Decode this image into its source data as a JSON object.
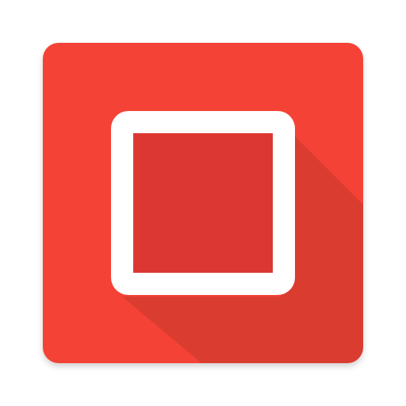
{
  "app_icon": {
    "icon_name": "stop-square-icon",
    "colors": {
      "tile_background": "#F44336",
      "long_shadow": "#C62828",
      "inner_square": "#E53935",
      "frame": "#FFFFFF",
      "page_background": "#FFFFFF"
    }
  }
}
